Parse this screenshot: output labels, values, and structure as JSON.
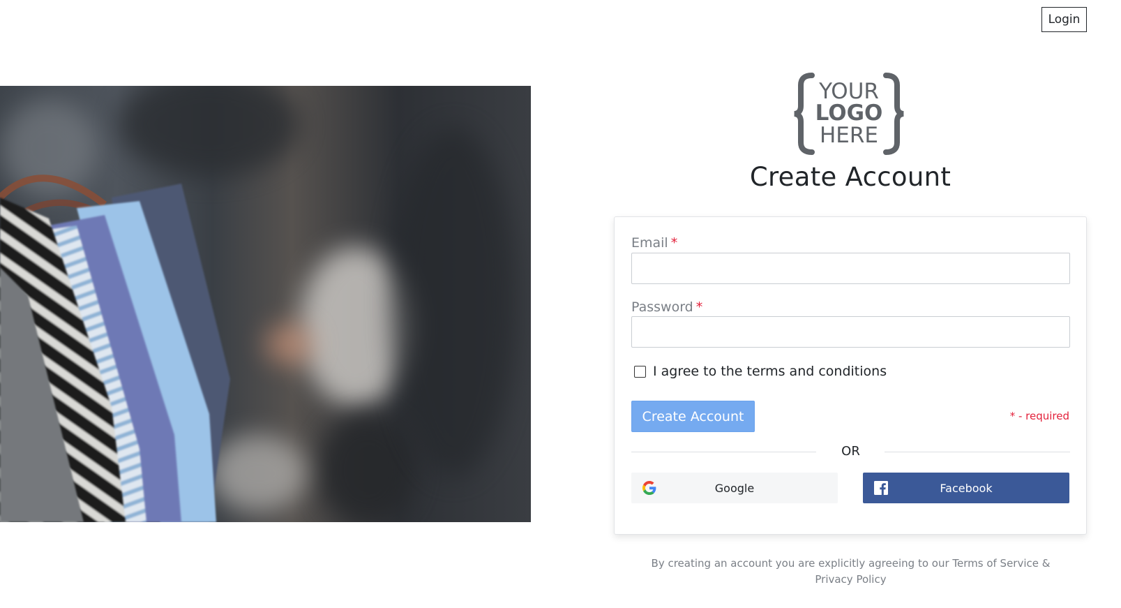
{
  "header": {
    "login_label": "Login"
  },
  "logo": {
    "line1": "YOUR",
    "line2": "LOGO",
    "line3": "HERE"
  },
  "page": {
    "title": "Create Account"
  },
  "form": {
    "email_label": "Email",
    "password_label": "Password",
    "required_mark": "*",
    "email_value": "",
    "password_value": "",
    "terms_label": "I agree to the terms and conditions",
    "terms_checked": false,
    "submit_label": "Create Account",
    "required_note": "* - required",
    "or_label": "OR",
    "google_label": "Google",
    "facebook_label": "Facebook"
  },
  "footer": {
    "note": "By creating an account you are explicitly agreeing to our Terms of Service & Privacy Policy"
  },
  "colors": {
    "primary_button": "#75aaf0",
    "facebook": "#3b5998",
    "required": "#e3213b"
  },
  "icons": [
    "google-icon",
    "facebook-icon"
  ]
}
